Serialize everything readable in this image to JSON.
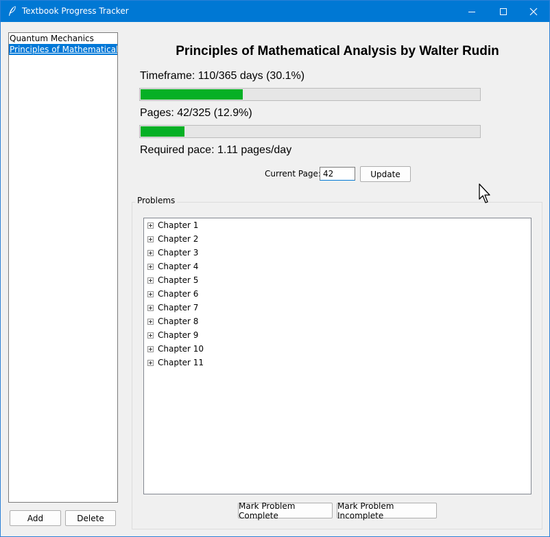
{
  "window": {
    "title": "Textbook Progress Tracker",
    "accent": "#0078d4"
  },
  "sidebar": {
    "books": [
      {
        "label": "Quantum Mechanics",
        "selected": false
      },
      {
        "label": "Principles of Mathematical Analysis by Walter Rudin",
        "selected": true
      }
    ],
    "add_label": "Add",
    "delete_label": "Delete"
  },
  "main": {
    "book_title": "Principles of Mathematical Analysis by Walter Rudin",
    "timeframe_label": "Timeframe: 110/365 days (30.1%)",
    "timeframe_progress": 0.301,
    "pages_label": "Pages: 42/325 (12.9%)",
    "pages_progress": 0.129,
    "pace_label": "Required pace: 1.11 pages/day",
    "current_page_label": "Current Page:",
    "current_page_value": "42",
    "update_label": "Update",
    "progress_color": "#06b025"
  },
  "problems": {
    "group_label": "Problems",
    "chapters": [
      "Chapter 1",
      "Chapter 2",
      "Chapter 3",
      "Chapter 4",
      "Chapter 5",
      "Chapter 6",
      "Chapter 7",
      "Chapter 8",
      "Chapter 9",
      "Chapter 10",
      "Chapter 11"
    ],
    "mark_complete_label": "Mark Problem Complete",
    "mark_incomplete_label": "Mark Problem Incomplete"
  }
}
